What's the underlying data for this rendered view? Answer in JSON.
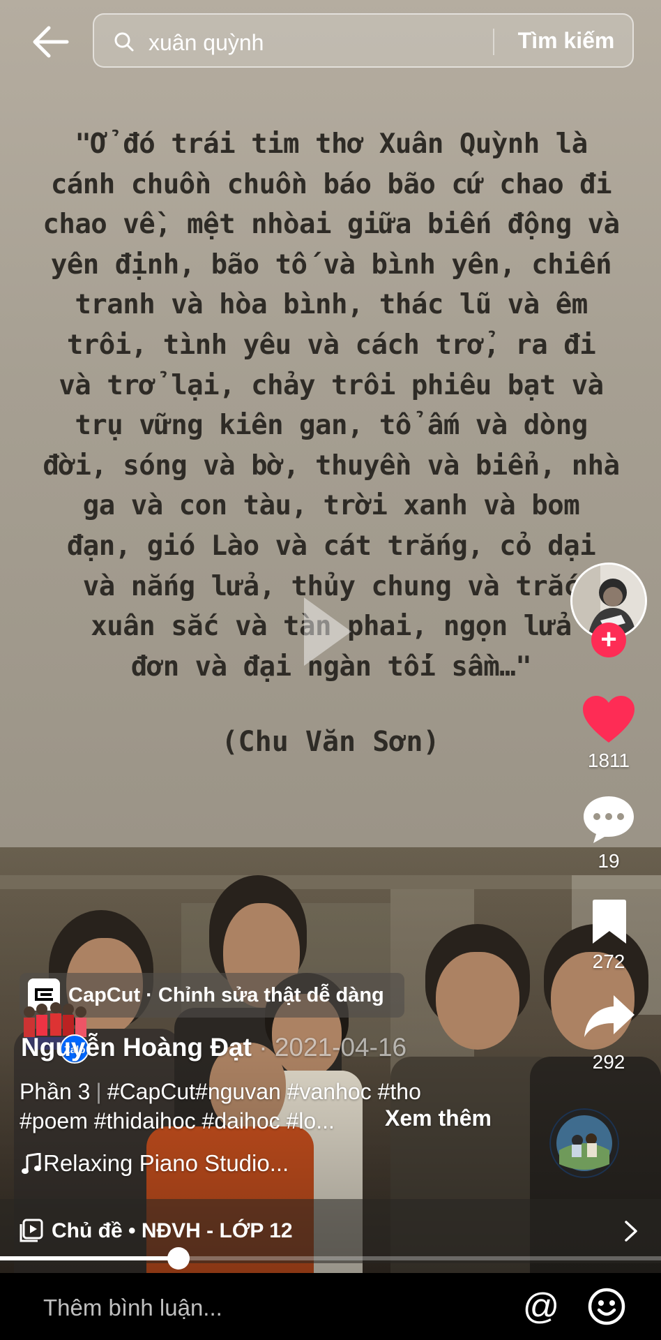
{
  "search": {
    "query": "xuân quỳnh",
    "button_label": "Tìm kiếm"
  },
  "video": {
    "quote_text": "\"Ở đó trái tim thơ Xuân Quỳnh là\ncánh chuồn chuồn báo bão cứ chao đi\nchao về, mệt nhòai giữa biến động và\nyên định, bão tố và bình yên, chiến\ntranh và hòa bình, thác lũ và êm\ntrôi, tình yêu và cách trở, ra đi\nvà trở lại, chảy trôi phiêu bạt và\ntrụ vững kiên gan, tổ ấm và dòng\nđời, sóng và bờ, thuyền và biển, nhà\nga và con tàu, trời xanh và bom\nđạn, gió Lào và cát trắng, cỏ dại\nvà nắng lửa, thủy chung và trắc\nxuân sắc và tàn phai, ngọn lửa\nđơn và đại ngàn tối sầm…\"",
    "quote_author": "(Chu Văn Sơn)"
  },
  "actions": {
    "likes": "1811",
    "comments": "19",
    "saves": "272",
    "shares": "292",
    "like_color": "#fe2c55"
  },
  "caption": {
    "capcut_label": "CapCut · Chỉnh sửa thật dễ dàng",
    "username": "Nguyễn Hoàng Đạt",
    "date": " · 2021-04-16",
    "zalo_badge": "Zalo",
    "part": "Phần 3",
    "line1_tags": "#CapCut#nguvan #vanhoc #tho",
    "line2_tags": "#poem #thidaihoc #daihoc #lo...",
    "see_more": "Xem thêm",
    "music": "Relaxing Piano Studio..."
  },
  "topic": {
    "label": "Chủ đề • NĐVH - LỚP 12"
  },
  "playback": {
    "progress": 0.27
  },
  "comment": {
    "placeholder": "Thêm bình luận..."
  }
}
